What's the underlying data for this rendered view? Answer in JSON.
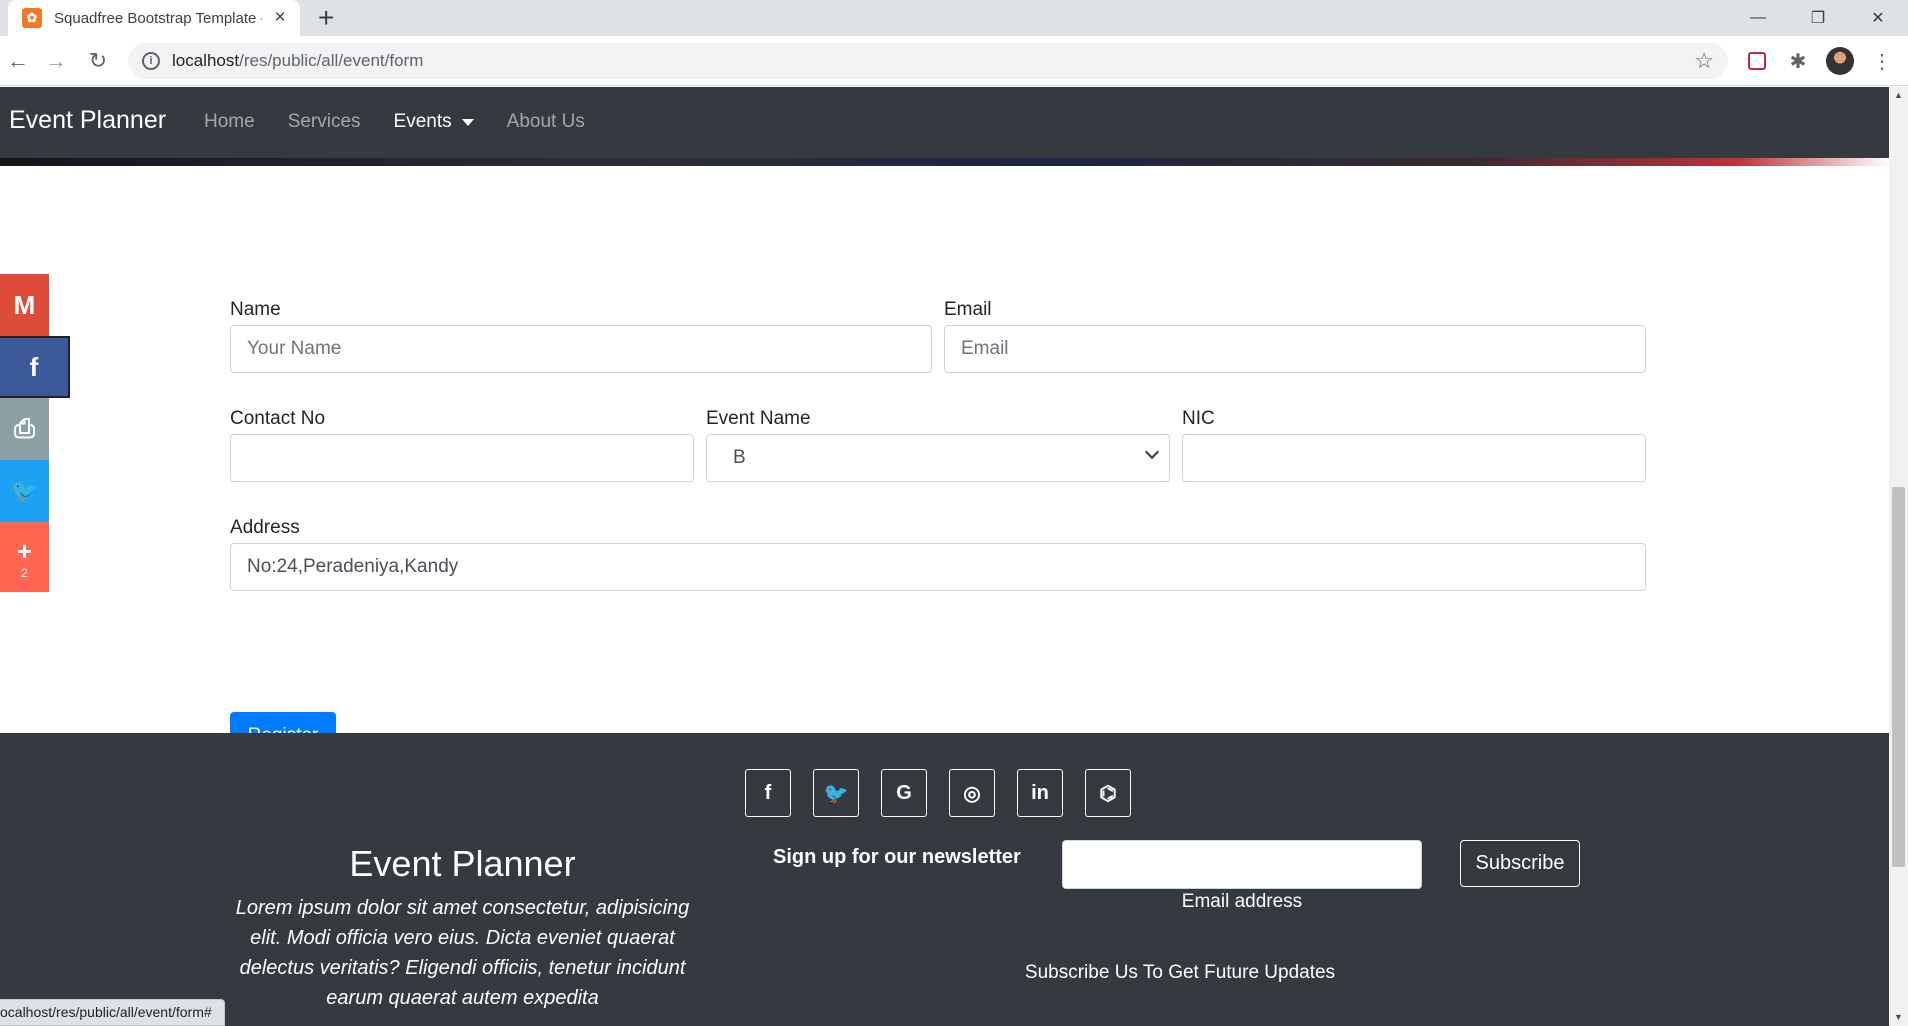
{
  "browser": {
    "tab_title": "Squadfree Bootstrap Template - E",
    "tab_favicon": "xampp-icon",
    "new_tab": "+",
    "close_tab": "×",
    "url_host": "localhost",
    "url_path": "/res/public/all/event/form",
    "window": {
      "minimize": "—",
      "maximize": "❐",
      "close": "✕"
    },
    "status_url": "ocalhost/res/public/all/event/form#"
  },
  "navbar": {
    "brand": "Event Planner",
    "links": [
      {
        "label": "Home",
        "active": false
      },
      {
        "label": "Services",
        "active": false
      },
      {
        "label": "Events",
        "active": true,
        "dropdown": true
      },
      {
        "label": "About Us",
        "active": false
      }
    ]
  },
  "share": {
    "items": [
      {
        "name": "gmail",
        "glyph": "M",
        "color": "#dd4b39"
      },
      {
        "name": "facebook",
        "glyph": "f",
        "color": "#3b5998"
      },
      {
        "name": "print",
        "glyph": "⎙",
        "color": "#8aa0a4"
      },
      {
        "name": "twitter",
        "glyph": "🐦",
        "color": "#1da1f2"
      },
      {
        "name": "more",
        "glyph": "+",
        "count": "2",
        "color": "#ff6550"
      }
    ]
  },
  "form": {
    "name_label": "Name",
    "name_placeholder": "Your Name",
    "email_label": "Email",
    "email_placeholder": "Email",
    "contact_label": "Contact No",
    "contact_value": "",
    "event_label": "Event Name",
    "event_selected": "B",
    "nic_label": "NIC",
    "nic_value": "",
    "address_label": "Address",
    "address_value": "No:24,Peradeniya,Kandy",
    "register_label": "Register"
  },
  "footer": {
    "social": [
      {
        "name": "facebook",
        "glyph": "f"
      },
      {
        "name": "twitter",
        "glyph": "🐦"
      },
      {
        "name": "google",
        "glyph": "G"
      },
      {
        "name": "instagram",
        "glyph": "◎"
      },
      {
        "name": "linkedin",
        "glyph": "in"
      },
      {
        "name": "github",
        "glyph": "⌬"
      }
    ],
    "brand": "Event Planner",
    "lorem": "Lorem ipsum dolor sit amet consectetur, adipisicing elit. Modi officia vero eius. Dicta eveniet quaerat delectus veritatis? Eligendi officiis, tenetur incidunt earum quaerat autem expedita",
    "newsletter_title": "Sign up for our newsletter",
    "email_hint": "Email address",
    "subscribe_label": "Subscribe",
    "subscribe_caption": "Subscribe Us To Get Future Updates"
  },
  "colors": {
    "navbar": "#343a40",
    "primary": "#007bff",
    "footer": "#343a40"
  }
}
